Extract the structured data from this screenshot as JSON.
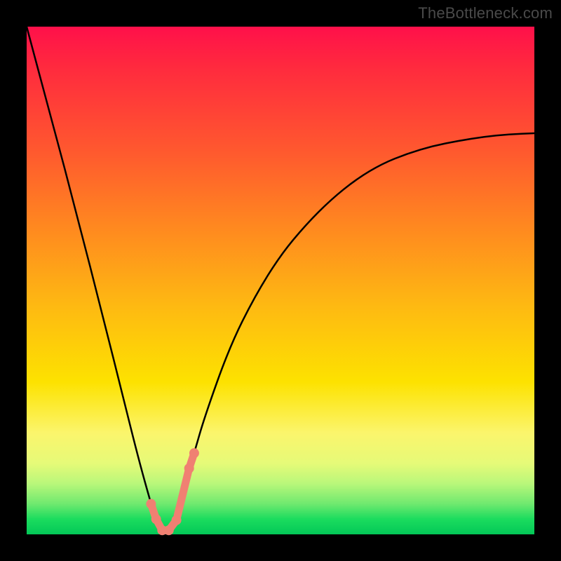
{
  "attribution": "TheBottleneck.com",
  "chart_data": {
    "type": "line",
    "title": "",
    "xlabel": "",
    "ylabel": "",
    "xlim": [
      0,
      1
    ],
    "ylim": [
      0,
      1
    ],
    "notes": "Axes are unlabeled. x and y are normalized to the plotting area (0–1). The black curve is a V-shaped valley with its minimum near x≈0.27 and y≈0. The right branch rises asymptotically toward y≈0.79 at x=1.",
    "series": [
      {
        "name": "curve",
        "color": "#000000",
        "x": [
          0.0,
          0.05,
          0.1,
          0.15,
          0.19,
          0.22,
          0.245,
          0.255,
          0.265,
          0.275,
          0.285,
          0.3,
          0.32,
          0.33,
          0.35,
          0.4,
          0.45,
          0.5,
          0.55,
          0.6,
          0.65,
          0.7,
          0.75,
          0.8,
          0.85,
          0.9,
          0.95,
          1.0
        ],
        "y": [
          1.0,
          0.815,
          0.625,
          0.43,
          0.27,
          0.15,
          0.06,
          0.03,
          0.005,
          0.005,
          0.02,
          0.06,
          0.13,
          0.16,
          0.23,
          0.37,
          0.47,
          0.55,
          0.61,
          0.66,
          0.7,
          0.73,
          0.75,
          0.765,
          0.775,
          0.783,
          0.788,
          0.79
        ]
      },
      {
        "name": "markers",
        "color": "#f08072",
        "type": "scatter",
        "x": [
          0.245,
          0.255,
          0.267,
          0.28,
          0.295,
          0.32,
          0.33
        ],
        "y": [
          0.06,
          0.03,
          0.008,
          0.008,
          0.028,
          0.13,
          0.16
        ]
      }
    ]
  }
}
